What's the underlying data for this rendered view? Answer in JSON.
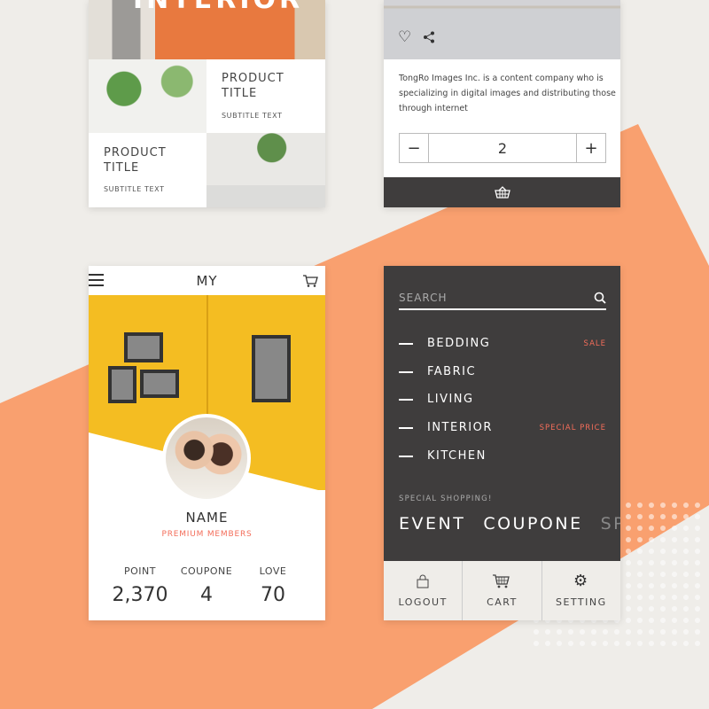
{
  "colors": {
    "background": "#efede9",
    "accent": "#f9a06f",
    "dark": "#3f3d3d",
    "highlight": "#f36d5a"
  },
  "card1": {
    "hero_text": "INTERIOR",
    "products": [
      {
        "title_l1": "PRODUCT",
        "title_l2": "TITLE",
        "subtitle": "SUBTITLE TEXT"
      },
      {
        "title_l1": "PRODUCT",
        "title_l2": "TITLE",
        "subtitle": "SUBTITLE TEXT"
      }
    ]
  },
  "card2": {
    "description": "TongRo Images Inc. is a content company who is specializing in digital images and distributing those through internet",
    "quantity": "2",
    "icons": [
      "heart-icon",
      "share-icon",
      "basket-icon"
    ]
  },
  "card3": {
    "title": "MY",
    "name": "NAME",
    "membership": "PREMIUM MEMBERS",
    "stats": [
      {
        "label": "POINT",
        "value": "2,370"
      },
      {
        "label": "COUPONE",
        "value": "4"
      },
      {
        "label": "LOVE",
        "value": "70"
      }
    ]
  },
  "card4": {
    "search_placeholder": "SEARCH",
    "menu": [
      {
        "label": "BEDDING",
        "tag": "SALE"
      },
      {
        "label": "FABRIC",
        "tag": ""
      },
      {
        "label": "LIVING",
        "tag": ""
      },
      {
        "label": "INTERIOR",
        "tag": "SPECIAL PRICE"
      },
      {
        "label": "KITCHEN",
        "tag": ""
      }
    ],
    "special_label": "SPECIAL SHOPPING!",
    "special_items": [
      "EVENT",
      "COUPONE",
      "SPE"
    ],
    "footer": [
      {
        "label": "LOGOUT",
        "icon": "lock-icon"
      },
      {
        "label": "CART",
        "icon": "cart-icon"
      },
      {
        "label": "SETTING",
        "icon": "gear-icon"
      }
    ]
  }
}
